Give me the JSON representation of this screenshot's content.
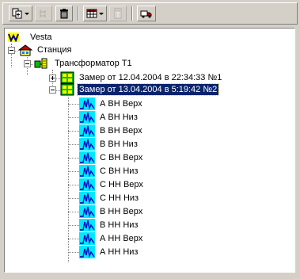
{
  "toolbar": {
    "buttons": [
      {
        "name": "add-node-icon",
        "dropdown": true
      },
      {
        "name": "tree-structure-icon",
        "disabled": true
      },
      {
        "name": "trash-icon"
      },
      {
        "name": "table-view-icon",
        "dropdown": true
      },
      {
        "name": "calculator-icon",
        "disabled": true
      },
      {
        "name": "truck-icon"
      }
    ]
  },
  "tree": {
    "root": {
      "label": "Vesta",
      "icon": "vesta-logo-icon"
    },
    "station": {
      "label": "Станция",
      "icon": "station-building-icon",
      "expanded": true
    },
    "transformer": {
      "label": "Трансформатор Т1",
      "icon": "transformer-icon",
      "expanded": true
    },
    "measurements": [
      {
        "label": "Замер от 12.04.2004 в 22:34:33  №1",
        "icon": "measurement-icon",
        "expanded": false,
        "selected": false
      },
      {
        "label": "Замер от 13.04.2004 в 5:19:42  №2",
        "icon": "measurement-icon",
        "expanded": true,
        "selected": true
      }
    ],
    "signals": [
      {
        "label": "А ВН Верх",
        "icon": "waveform-icon"
      },
      {
        "label": "А ВН Низ",
        "icon": "waveform-icon"
      },
      {
        "label": "В ВН Верх",
        "icon": "waveform-icon"
      },
      {
        "label": "В ВН Низ",
        "icon": "waveform-icon"
      },
      {
        "label": "С ВН Верх",
        "icon": "waveform-icon"
      },
      {
        "label": "С ВН Низ",
        "icon": "waveform-icon"
      },
      {
        "label": "С НН Верх",
        "icon": "waveform-icon"
      },
      {
        "label": "С НН Низ",
        "icon": "waveform-icon"
      },
      {
        "label": "В НН Верх",
        "icon": "waveform-icon"
      },
      {
        "label": "В НН Низ",
        "icon": "waveform-icon"
      },
      {
        "label": "А НН Верх",
        "icon": "waveform-icon"
      },
      {
        "label": "А НН Низ",
        "icon": "waveform-icon"
      }
    ]
  }
}
